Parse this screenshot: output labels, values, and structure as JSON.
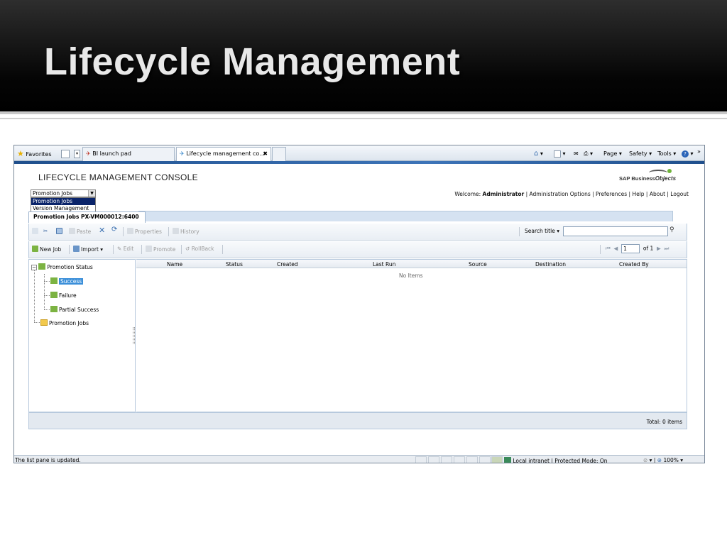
{
  "slide": {
    "title": "Lifecycle Management"
  },
  "ie": {
    "favorites": "Favorites",
    "tabs": [
      "BI launch pad",
      "Lifecycle management co..."
    ],
    "tab_close": "✖",
    "cmd": {
      "page": "Page ▾",
      "safety": "Safety ▾",
      "tools": "Tools ▾",
      "more": "»"
    }
  },
  "app": {
    "title": "LIFECYCLE MANAGEMENT CONSOLE",
    "logo": {
      "prefix": "SAP Business",
      "suffix": "Objects"
    },
    "dropdown": {
      "selected": "Promotion Jobs",
      "options": [
        "Promotion Jobs",
        "Version Management"
      ]
    },
    "welcome": {
      "prefix": "Welcome: ",
      "user": "Administrator",
      "links": " | Administration Options | Preferences | Help | About | Logout"
    },
    "job_tab": "Promotion Jobs PX-VM000012:6400",
    "toolbar1": {
      "paste": "Paste",
      "properties": "Properties",
      "history": "History",
      "search_label": "Search title",
      "search_arrow": "▾",
      "search_value": ""
    },
    "toolbar2": {
      "new_job": "New Job",
      "import": "Import",
      "import_arrow": "▾",
      "edit": "Edit",
      "promote": "Promote",
      "rollback": "RollBack"
    },
    "pager": {
      "page": "1",
      "of": "of 1"
    },
    "tree": {
      "root": "Promotion Status",
      "children": [
        "Success",
        "Failure",
        "Partial Success"
      ],
      "jobs": "Promotion Jobs"
    },
    "grid": {
      "columns": [
        "Name",
        "Status",
        "Created",
        "Last Run",
        "Source",
        "Destination",
        "Created By"
      ],
      "empty": "No Items"
    },
    "total": "Total: 0 items"
  },
  "statusbar": {
    "text": "The list pane is updated.",
    "zone": "Local intranet | Protected Mode: On",
    "zoom": "100%"
  },
  "colors": {
    "accent": "#3b8fd9",
    "header_bg": "#000000",
    "panel_border": "#b7c9dd"
  }
}
